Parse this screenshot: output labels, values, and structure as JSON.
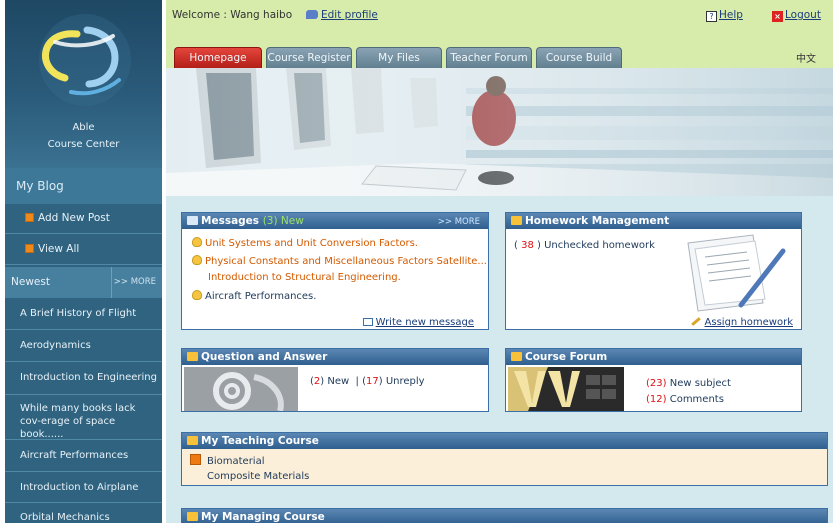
{
  "sidebar": {
    "logo_line1": "Able",
    "logo_line2": "Course Center",
    "blog_title": "My Blog",
    "actions": [
      {
        "label": "Add New Post",
        "icon": "plus-icon"
      },
      {
        "label": "View All",
        "icon": "list-icon"
      }
    ],
    "newest_label": "Newest",
    "newest_more": ">> MORE",
    "posts": [
      "A Brief History of Flight",
      "Aerodynamics",
      "Introduction to Engineering",
      "While many books lack cov-erage of space book......",
      "Aircraft Performances",
      "Introduction to Airplane",
      "Orbital Mechanics"
    ]
  },
  "topbar": {
    "welcome": "Welcome : Wang haibo",
    "edit_profile": "Edit profile",
    "help": "Help",
    "logout": "Logout",
    "language": "中文"
  },
  "tabs": [
    "Homepage",
    "Course Register",
    "My Files",
    "Teacher Forum",
    "Course Build"
  ],
  "messages": {
    "title": "Messages",
    "new_count": "(3) New",
    "more": ">> MORE",
    "items": [
      "Unit Systems and Unit Conversion Factors.",
      "Physical Constants and Miscellaneous Factors Satellite...",
      "Introduction to Structural Engineering.",
      "Aircraft Performances."
    ],
    "write_new": "Write new message"
  },
  "homework": {
    "title": "Homework Management",
    "count": "38",
    "label": "Unchecked homework",
    "assign": "Assign homework"
  },
  "qa": {
    "title": "Question and Answer",
    "new_count": "2",
    "new_label": "New",
    "unreply_count": "17",
    "unreply_label": "Unreply"
  },
  "forum": {
    "title": "Course Forum",
    "subject_count": "(23)",
    "subject_label": "New subject",
    "comments_count": "(12)",
    "comments_label": "Comments"
  },
  "teaching": {
    "title": "My Teaching Course",
    "courses": [
      "Biomaterial",
      "Composite Materials"
    ]
  },
  "managing": {
    "title": "My Managing Course"
  }
}
